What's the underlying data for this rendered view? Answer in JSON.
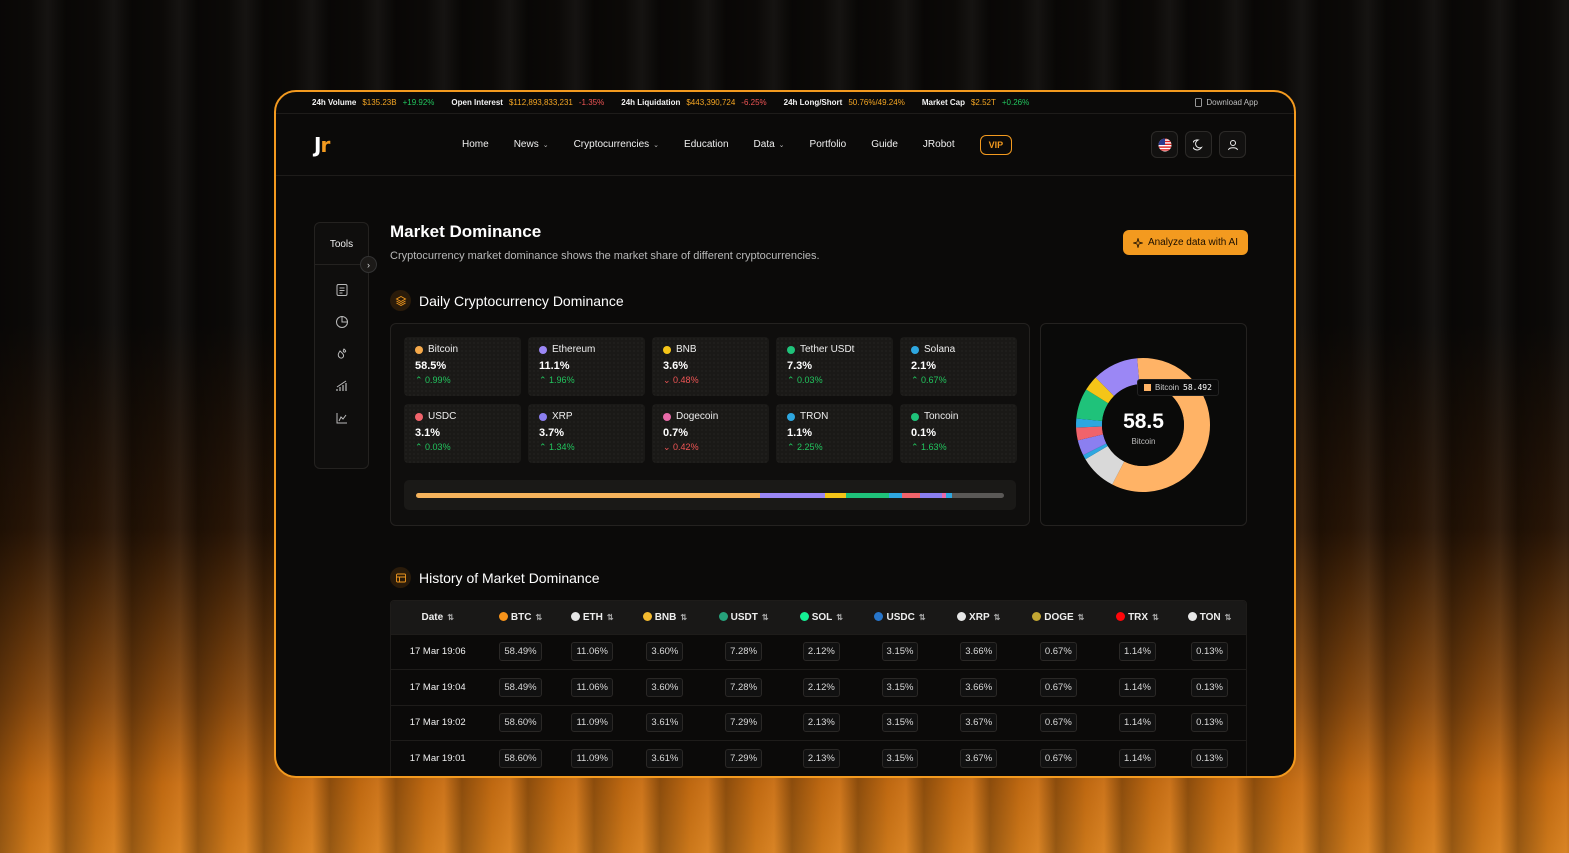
{
  "ticker": {
    "items": [
      {
        "label": "24h Volume",
        "value": "$135.23B",
        "change": "+19.92%",
        "dir": "up"
      },
      {
        "label": "Open Interest",
        "value": "$112,893,833,231",
        "change": "-1.35%",
        "dir": "down"
      },
      {
        "label": "24h Liquidation",
        "value": "$443,390,724",
        "change": "-6.25%",
        "dir": "down"
      },
      {
        "label": "24h Long/Short",
        "value": "50.76%/49.24%",
        "change": "",
        "dir": ""
      },
      {
        "label": "Market Cap",
        "value": "$2.52T",
        "change": "+0.26%",
        "dir": "up"
      }
    ],
    "download": "Download App"
  },
  "header": {
    "logo_j": "J",
    "logo_r": "r",
    "nav": [
      {
        "label": "Home",
        "dropdown": false
      },
      {
        "label": "News",
        "dropdown": true
      },
      {
        "label": "Cryptocurrencies",
        "dropdown": true
      },
      {
        "label": "Education",
        "dropdown": false
      },
      {
        "label": "Data",
        "dropdown": true
      },
      {
        "label": "Portfolio",
        "dropdown": false
      },
      {
        "label": "Guide",
        "dropdown": false
      },
      {
        "label": "JRobot",
        "dropdown": false
      }
    ],
    "vip": "VIP"
  },
  "tools": {
    "title": "Tools"
  },
  "page": {
    "title": "Market Dominance",
    "subtitle": "Cryptocurrency market dominance shows the market share of different cryptocurrencies.",
    "ai_button": "Analyze data with AI",
    "daily_title": "Daily Cryptocurrency Dominance",
    "history_title": "History of Market Dominance"
  },
  "cards": [
    {
      "name": "Bitcoin",
      "value": "58.5%",
      "change": "0.99%",
      "dir": "up",
      "color": "#f5a94a"
    },
    {
      "name": "Ethereum",
      "value": "11.1%",
      "change": "1.96%",
      "dir": "up",
      "color": "#9b87f5"
    },
    {
      "name": "BNB",
      "value": "3.6%",
      "change": "0.48%",
      "dir": "down",
      "color": "#f5c518"
    },
    {
      "name": "Tether USDt",
      "value": "7.3%",
      "change": "0.03%",
      "dir": "up",
      "color": "#1fc27a"
    },
    {
      "name": "Solana",
      "value": "2.1%",
      "change": "0.67%",
      "dir": "up",
      "color": "#2ea7e0"
    },
    {
      "name": "USDC",
      "value": "3.1%",
      "change": "0.03%",
      "dir": "up",
      "color": "#f0636b"
    },
    {
      "name": "XRP",
      "value": "3.7%",
      "change": "1.34%",
      "dir": "up",
      "color": "#8b7ff0"
    },
    {
      "name": "Dogecoin",
      "value": "0.7%",
      "change": "0.42%",
      "dir": "down",
      "color": "#e86aa8"
    },
    {
      "name": "TRON",
      "value": "1.1%",
      "change": "2.25%",
      "dir": "up",
      "color": "#2ea7e0"
    },
    {
      "name": "Toncoin",
      "value": "0.1%",
      "change": "1.63%",
      "dir": "up",
      "color": "#1fc27a"
    }
  ],
  "dominance_bar": [
    {
      "name": "Bitcoin",
      "share": 58.5,
      "color": "#f5b35c"
    },
    {
      "name": "Ethereum",
      "share": 11.1,
      "color": "#9b87f5"
    },
    {
      "name": "BNB",
      "share": 3.6,
      "color": "#f5c518"
    },
    {
      "name": "Tether USDt",
      "share": 7.3,
      "color": "#1fc27a"
    },
    {
      "name": "Solana",
      "share": 2.1,
      "color": "#2ea7e0"
    },
    {
      "name": "USDC",
      "share": 3.1,
      "color": "#f0636b"
    },
    {
      "name": "XRP",
      "share": 3.7,
      "color": "#8b7ff0"
    },
    {
      "name": "Dogecoin",
      "share": 0.7,
      "color": "#e86aa8"
    },
    {
      "name": "TRON",
      "share": 1.1,
      "color": "#2ea7e0"
    },
    {
      "name": "Others",
      "share": 8.8,
      "color": "#5a5856"
    }
  ],
  "donut": {
    "center_value": "58.5",
    "center_label": "Bitcoin",
    "tooltip_name": "Bitcoin",
    "tooltip_value": "58.492",
    "segments": [
      {
        "name": "Bitcoin",
        "share": 58.5,
        "color": "#ffb366"
      },
      {
        "name": "Others",
        "share": 8.8,
        "color": "#d9d9d9"
      },
      {
        "name": "TRON",
        "share": 1.1,
        "color": "#2ea7e0"
      },
      {
        "name": "XRP",
        "share": 3.7,
        "color": "#8b7ff0"
      },
      {
        "name": "USDC",
        "share": 3.1,
        "color": "#f0636b"
      },
      {
        "name": "Solana",
        "share": 2.1,
        "color": "#2ea7e0"
      },
      {
        "name": "Tether USDt",
        "share": 7.3,
        "color": "#1fc27a"
      },
      {
        "name": "BNB",
        "share": 3.6,
        "color": "#f5c518"
      },
      {
        "name": "Ethereum",
        "share": 11.1,
        "color": "#9b87f5"
      }
    ]
  },
  "table": {
    "columns": [
      {
        "label": "Date",
        "color": ""
      },
      {
        "label": "BTC",
        "color": "#f7931a"
      },
      {
        "label": "ETH",
        "color": "#e6e6e6"
      },
      {
        "label": "BNB",
        "color": "#f3ba2f"
      },
      {
        "label": "USDT",
        "color": "#26a17b"
      },
      {
        "label": "SOL",
        "color": "#14f195"
      },
      {
        "label": "USDC",
        "color": "#2775ca"
      },
      {
        "label": "XRP",
        "color": "#e6e6e6"
      },
      {
        "label": "DOGE",
        "color": "#c2a633"
      },
      {
        "label": "TRX",
        "color": "#ff060a"
      },
      {
        "label": "TON",
        "color": "#e6e6e6"
      }
    ],
    "rows": [
      [
        "17 Mar 19:06",
        "58.49%",
        "11.06%",
        "3.60%",
        "7.28%",
        "2.12%",
        "3.15%",
        "3.66%",
        "0.67%",
        "1.14%",
        "0.13%"
      ],
      [
        "17 Mar 19:04",
        "58.49%",
        "11.06%",
        "3.60%",
        "7.28%",
        "2.12%",
        "3.15%",
        "3.66%",
        "0.67%",
        "1.14%",
        "0.13%"
      ],
      [
        "17 Mar 19:02",
        "58.60%",
        "11.09%",
        "3.61%",
        "7.29%",
        "2.13%",
        "3.15%",
        "3.67%",
        "0.67%",
        "1.14%",
        "0.13%"
      ],
      [
        "17 Mar 19:01",
        "58.60%",
        "11.09%",
        "3.61%",
        "7.29%",
        "2.13%",
        "3.15%",
        "3.67%",
        "0.67%",
        "1.14%",
        "0.13%"
      ]
    ]
  }
}
